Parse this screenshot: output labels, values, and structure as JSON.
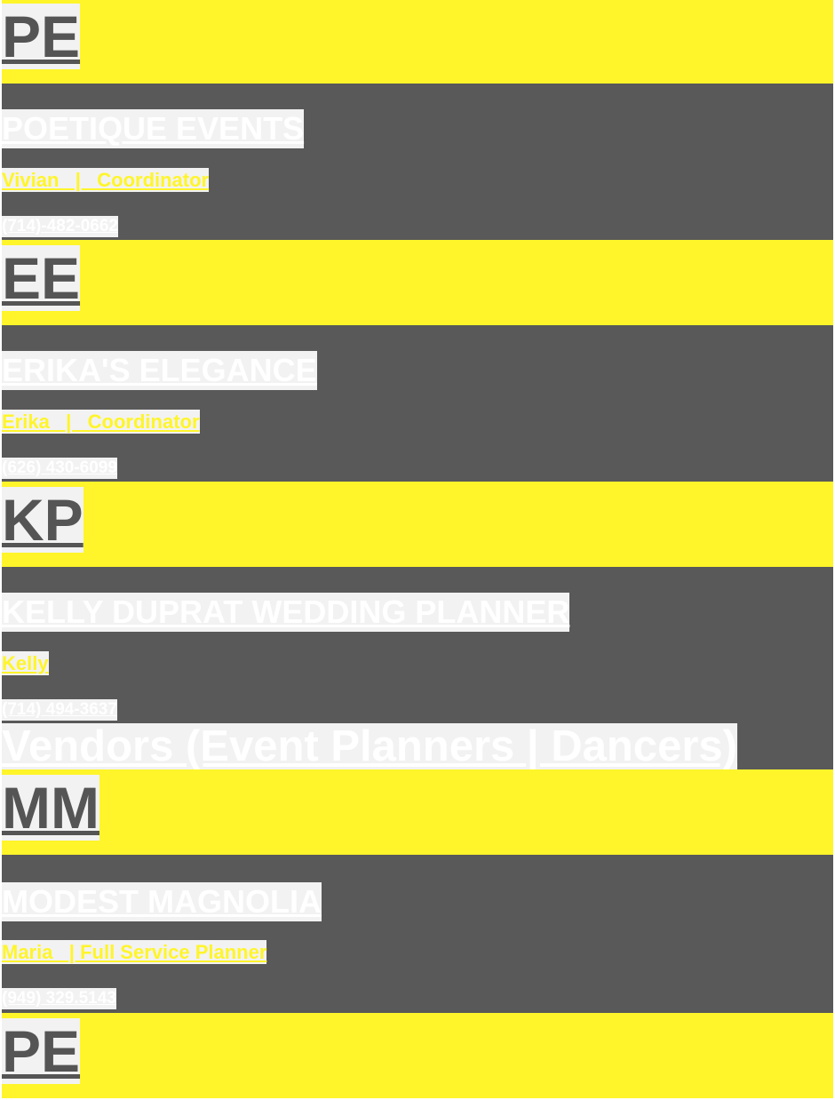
{
  "colors": {
    "accent_yellow": "#fff52a",
    "dark_band": "#595959",
    "text_gray": "#555555",
    "highlight": "#f2f2f2"
  },
  "vendors_top": [
    {
      "initials": "PE",
      "name": "POETIQUE EVENTS",
      "contact": "Vivian   |   Coordinator",
      "phone": "(714)-482-0662"
    },
    {
      "initials": "EE",
      "name": "ERIKA'S ELEGANCE",
      "contact": "Erika   |   Coordinator",
      "phone": "(626) 430-6099"
    },
    {
      "initials": "KP",
      "name": "KELLY DUPRAT WEDDING PLANNER",
      "contact": "Kelly",
      "phone": "(714) 494-3637"
    }
  ],
  "section": {
    "heading": "Vendors (Event Planners | Dancers)"
  },
  "vendors_bottom": [
    {
      "initials": "MM",
      "name": "MODEST MAGNOLIA",
      "contact": "Maria   | Full Service Planner",
      "phone": "(949) 329.5143"
    },
    {
      "initials": "PE"
    }
  ]
}
